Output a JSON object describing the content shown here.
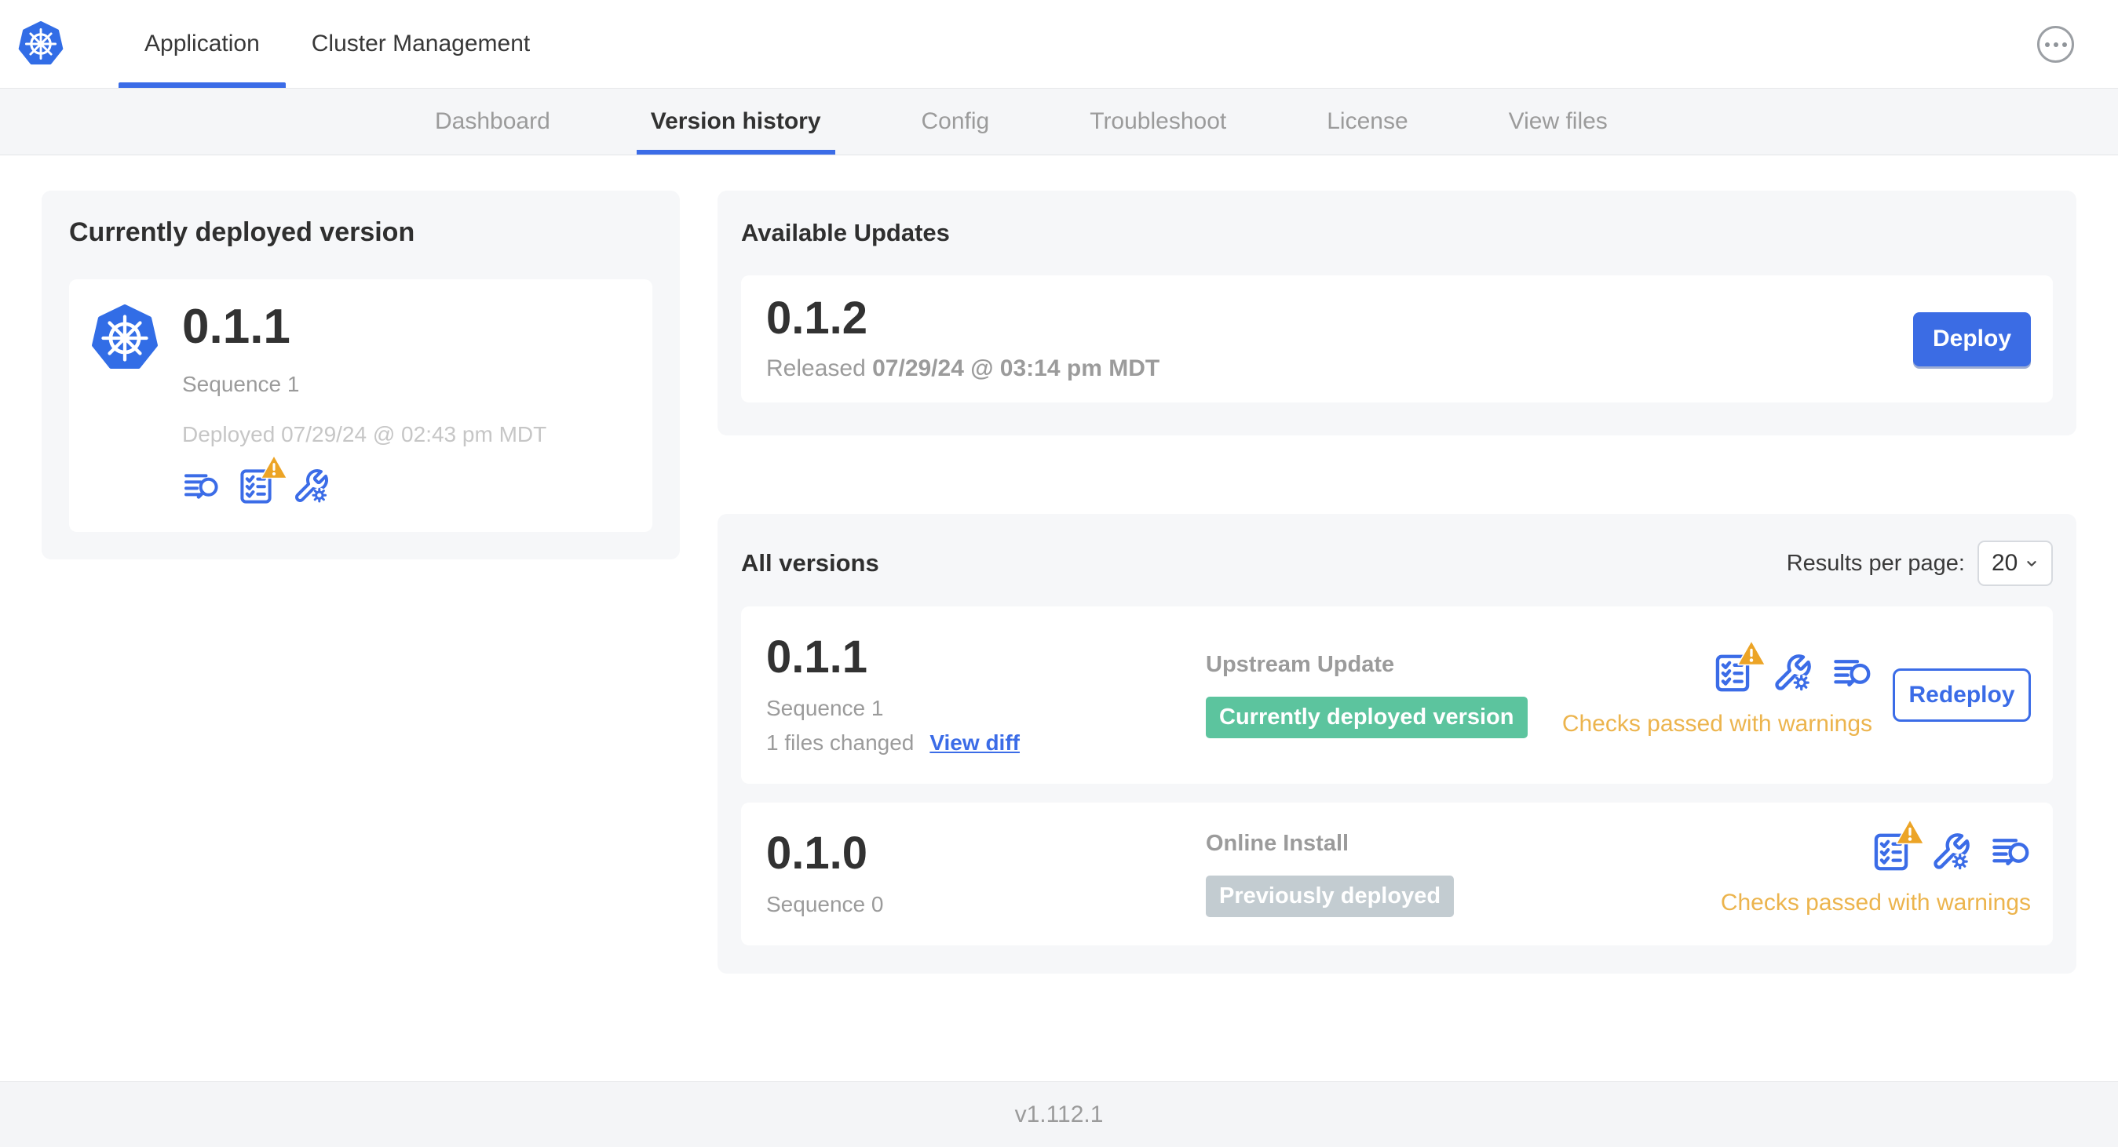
{
  "header": {
    "tabs": [
      {
        "label": "Application"
      },
      {
        "label": "Cluster Management"
      }
    ]
  },
  "subnav": {
    "tabs": [
      {
        "label": "Dashboard"
      },
      {
        "label": "Version history"
      },
      {
        "label": "Config"
      },
      {
        "label": "Troubleshoot"
      },
      {
        "label": "License"
      },
      {
        "label": "View files"
      }
    ]
  },
  "currently_deployed": {
    "title": "Currently deployed version",
    "version": "0.1.1",
    "sequence": "Sequence 1",
    "deployed_at": "Deployed 07/29/24 @ 02:43 pm MDT"
  },
  "available_updates": {
    "title": "Available Updates",
    "version": "0.1.2",
    "released_label": "Released",
    "released_at": "07/29/24 @ 03:14 pm MDT",
    "deploy_label": "Deploy"
  },
  "all_versions": {
    "title": "All versions",
    "results_per_page_label": "Results per page:",
    "results_per_page": "20",
    "rows": [
      {
        "version": "0.1.1",
        "sequence": "Sequence 1",
        "files_changed": "1 files changed",
        "view_diff_label": "View diff",
        "source": "Upstream Update",
        "badge": "Currently deployed version",
        "action_label": "Redeploy",
        "status": "Checks passed with warnings"
      },
      {
        "version": "0.1.0",
        "sequence": "Sequence 0",
        "source": "Online Install",
        "badge": "Previously deployed",
        "status": "Checks passed with warnings"
      }
    ]
  },
  "footer": {
    "app_version": "v1.112.1"
  },
  "colors": {
    "accent_blue": "#3b6ce7",
    "logo_blue": "#326de6",
    "badge_green": "#5cc49e",
    "badge_gray": "#c3ccd1",
    "warning_triangle": "#eca426",
    "warning_text": "#ecb44d"
  }
}
